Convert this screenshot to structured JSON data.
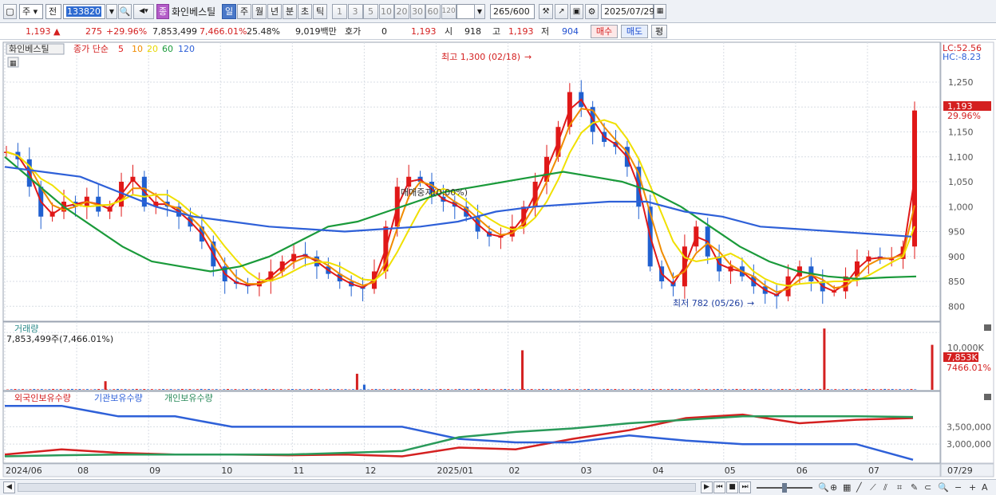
{
  "toolbar": {
    "market_select": "주",
    "price_type": "전",
    "stock_code": "133820",
    "stock_badge": "종",
    "stock_name": "화인베스틸",
    "periods": [
      "일",
      "주",
      "월",
      "년",
      "분",
      "초",
      "틱"
    ],
    "selected_period": "일",
    "intervals": [
      "1",
      "3",
      "5",
      "10",
      "20",
      "30",
      "60",
      "120"
    ],
    "count_value": "265",
    "count_max": "/600",
    "date_value": "2025/07/29"
  },
  "quote": {
    "price": "1,193",
    "change": "275",
    "change_rate": "+29.96%",
    "volume": "7,853,499",
    "volume_rate": "7,466.01%",
    "turnover": "25.48%",
    "amount": "9,019백만",
    "hoga_label": "호가",
    "hoga_value": "0",
    "hoga_price": "1,193",
    "open_label": "시",
    "open": "918",
    "high_label": "고",
    "high": "1,193",
    "low_label": "저",
    "low": "904",
    "buy_label": "매수",
    "sell_label": "매도",
    "eval_label": "평"
  },
  "chart_data": [
    {
      "type": "candlestick",
      "panel": "price",
      "legend_name": "화인베스틸",
      "ma_label": "종가 단순",
      "moving_averages": [
        {
          "period": "5",
          "color": "#e01818"
        },
        {
          "period": "10",
          "color": "#f08c00"
        },
        {
          "period": "20",
          "color": "#f0e000"
        },
        {
          "period": "60",
          "color": "#1a9a3a"
        },
        {
          "period": "120",
          "color": "#2e60d8"
        }
      ],
      "y_ticks": [
        "1,250",
        "1,200",
        "1,150",
        "1,100",
        "1,050",
        "1,000",
        "950",
        "900",
        "850",
        "800"
      ],
      "ylim": [
        770,
        1330
      ],
      "lc": "LC:52.56",
      "hc": "HC:-8.23",
      "current_price": "1,193",
      "current_rate": "29.96%",
      "high_marker": "최고 1,300 (02/18)",
      "low_marker": "최저 782 (05/26)",
      "mid_annotation": "매매중지(0.00%)",
      "close_series": [
        1110,
        1095,
        1040,
        980,
        990,
        1010,
        1000,
        1020,
        990,
        1000,
        1050,
        1060,
        1000,
        1010,
        1000,
        980,
        960,
        930,
        880,
        850,
        845,
        840,
        850,
        870,
        890,
        905,
        900,
        880,
        865,
        850,
        840,
        835,
        870,
        960,
        1040,
        1060,
        1050,
        1020,
        1010,
        1000,
        980,
        950,
        940,
        940,
        960,
        1000,
        1050,
        1100,
        1160,
        1230,
        1200,
        1150,
        1130,
        1120,
        1080,
        1000,
        880,
        850,
        840,
        920,
        960,
        900,
        870,
        880,
        860,
        840,
        825,
        820,
        860,
        880,
        850,
        830,
        830,
        860,
        890,
        900,
        895,
        895,
        920,
        1193
      ],
      "ma60_series": [
        1100,
        1050,
        1000,
        960,
        920,
        890,
        880,
        870,
        880,
        900,
        930,
        960,
        970,
        990,
        1010,
        1030,
        1040,
        1050,
        1060,
        1070,
        1060,
        1050,
        1030,
        1000,
        960,
        920,
        890,
        870,
        860,
        855,
        858,
        860
      ],
      "ma120_series": [
        1080,
        1070,
        1060,
        1030,
        1000,
        980,
        970,
        960,
        955,
        950,
        955,
        960,
        970,
        990,
        1000,
        1005,
        1010,
        1010,
        990,
        980,
        960,
        955,
        950,
        945,
        940
      ],
      "x_ticks": [
        "2024/06",
        "08",
        "09",
        "10",
        "11",
        "12",
        "2025/01",
        "02",
        "03",
        "04",
        "05",
        "06",
        "07"
      ],
      "x_end_label": "07/29"
    },
    {
      "type": "bar",
      "panel": "volume",
      "title": "거래량",
      "subtitle": "7,853,499주(7,466.01%)",
      "y_tick": "10,000K",
      "current_value": "7,853K",
      "current_rate": "7466.01%",
      "spikes": [
        {
          "month_index": 1.4,
          "value_k": 1500
        },
        {
          "month_index": 4.9,
          "value_k": 2800
        },
        {
          "month_index": 5.0,
          "value_k": 900
        },
        {
          "month_index": 7.2,
          "value_k": 6900
        },
        {
          "month_index": 11.4,
          "value_k": 10700
        },
        {
          "month_index": 12.9,
          "value_k": 7853
        }
      ]
    },
    {
      "type": "line",
      "panel": "holdings",
      "series": [
        {
          "name": "외국인보유수량",
          "color": "#d42020",
          "values": [
            2700000,
            2850000,
            2750000,
            2700000,
            2700000,
            2680000,
            2700000,
            2650000,
            2900000,
            2850000,
            3150000,
            3400000,
            3750000,
            3850000,
            3600000,
            3700000,
            3750000
          ]
        },
        {
          "name": "기관보유수량",
          "color": "#2e60d8",
          "values": [
            4100000,
            4100000,
            3800000,
            3800000,
            3500000,
            3500000,
            3500000,
            3500000,
            3150000,
            3050000,
            3050000,
            3250000,
            3100000,
            3000000,
            3000000,
            3000000,
            2550000
          ]
        },
        {
          "name": "개인보유수량",
          "color": "#2a9a5a",
          "values": [
            2650000,
            2680000,
            2700000,
            2700000,
            2700000,
            2700000,
            2750000,
            2800000,
            3200000,
            3350000,
            3450000,
            3600000,
            3700000,
            3800000,
            3800000,
            3800000,
            3780000
          ]
        }
      ],
      "y_ticks": [
        "3,500,000",
        "3,000,000"
      ]
    }
  ]
}
